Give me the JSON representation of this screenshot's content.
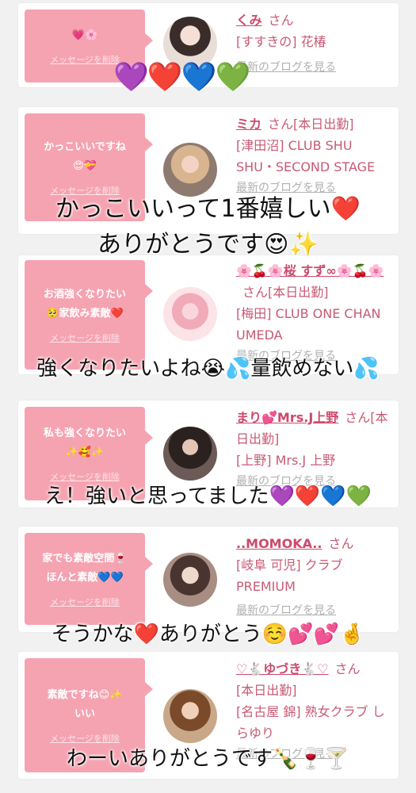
{
  "cards": [
    {
      "message": "💗🌸",
      "delete_label": "メッセージを削除",
      "name": "くみ",
      "san": "さん",
      "shop": "[すすきの] 花椿",
      "blog": "最新のブログを見る"
    },
    {
      "message": "かっこいいですね\n😍💝",
      "delete_label": "メッセージを削除",
      "name": "ミカ",
      "san": "さん[本日出勤]",
      "shop": "[津田沼] CLUB SHU SHU・SECOND STAGE",
      "blog": "最新のブログを見る"
    },
    {
      "message": "お酒強くなりたい\n🥺家飲み素敵❤️",
      "delete_label": "メッセージを削除",
      "name": "🌸🍒🌸桜 すず∞🌸🍒🌸",
      "san": "さん[本日出勤]",
      "shop": "[梅田] CLUB ONE CHAN UMEDA",
      "blog": "最新のブログを見る"
    },
    {
      "message": "私も強くなりたい\n✨🥰✨",
      "delete_label": "メッセージを削除",
      "name": "まり💕Mrs.J上野",
      "san": "さん[本日出勤]",
      "shop": "[上野] Mrs.J 上野",
      "blog": "最新のブログを見る"
    },
    {
      "message": "家でも素敵空間🍷\nほんと素敵💙💙",
      "delete_label": "メッセージを削除",
      "name": "..MOMOKA..",
      "san": "さん",
      "shop": "[岐阜 可児] クラブ PREMIUM",
      "blog": "最新のブログを見る"
    },
    {
      "message": "素敵ですね😊✨\nいい",
      "delete_label": "メッセージを削除",
      "name": "♡🐇ゆづき🐇♡",
      "san": "さん",
      "status": "[本日出勤]",
      "shop": "[名古屋 錦] 熟女クラブ しらゆり",
      "blog": "最新のブログを見る"
    }
  ],
  "overlays": {
    "hearts_1": "💜❤️💙💚",
    "caption_2a": "かっこいいって1番嬉しい❤️",
    "caption_2b": "ありがとうです😍✨",
    "caption_3": "強くなりたいよね😭💦量飲めない💦",
    "caption_4": "え！強いと思ってました💜❤️💙💚",
    "caption_5": "そうかな❤️ありがとう☺️💕💕🤞",
    "caption_6": "わーいありがとうです🍾🍷🍸"
  },
  "colors": {
    "bubble": "#f5a3b1",
    "name": "#cc4a6c",
    "background": "#f1f1f1"
  }
}
